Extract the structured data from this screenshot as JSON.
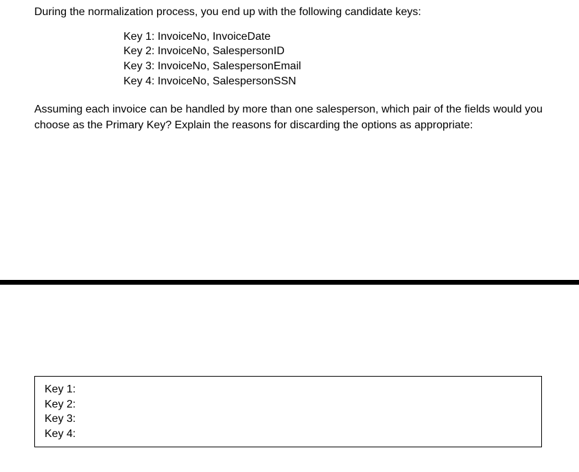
{
  "intro": "During the normalization process, you end up with the following candidate keys:",
  "keys": [
    "Key 1: InvoiceNo, InvoiceDate",
    "Key 2: InvoiceNo, SalespersonID",
    "Key 3: InvoiceNo, SalespersonEmail",
    "Key 4: InvoiceNo, SalespersonSSN"
  ],
  "question": "Assuming each invoice can be handled by more than one salesperson, which pair of the fields would you choose as the Primary Key? Explain the reasons for discarding the options as appropriate:",
  "answer_labels": [
    "Key 1:",
    "Key 2:",
    "Key 3:",
    "Key 4:"
  ]
}
